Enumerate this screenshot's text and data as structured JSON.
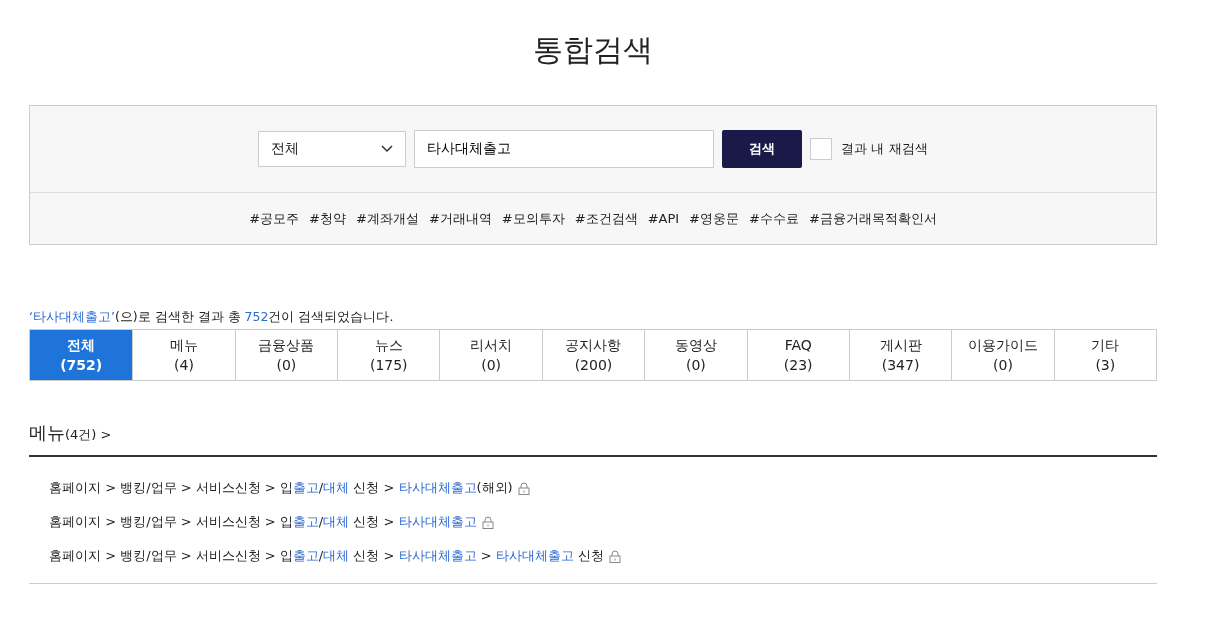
{
  "page_title": "통합검색",
  "search": {
    "category": "전체",
    "query": "타사대체출고",
    "button": "검색",
    "research": {
      "label": "결과 내 재검색",
      "checked": false
    }
  },
  "hashtags": [
    "#공모주",
    "#청약",
    "#계좌개설",
    "#거래내역",
    "#모의투자",
    "#조건검색",
    "#API",
    "#영웅문",
    "#수수료",
    "#금융거래목적확인서"
  ],
  "summary": [
    {
      "text": "‘타사대체출고’",
      "highlight": true
    },
    {
      "text": "(으)로 검색한 결과 총 ",
      "highlight": false
    },
    {
      "text": "752",
      "highlight": true
    },
    {
      "text": "건이 검색되었습니다.",
      "highlight": false
    }
  ],
  "tabs": [
    {
      "label": "전체",
      "count": "(752)",
      "selected": true
    },
    {
      "label": "메뉴",
      "count": "(4)",
      "selected": false
    },
    {
      "label": "금융상품",
      "count": "(0)",
      "selected": false
    },
    {
      "label": "뉴스",
      "count": "(175)",
      "selected": false
    },
    {
      "label": "리서치",
      "count": "(0)",
      "selected": false
    },
    {
      "label": "공지사항",
      "count": "(200)",
      "selected": false
    },
    {
      "label": "동영상",
      "count": "(0)",
      "selected": false
    },
    {
      "label": "FAQ",
      "count": "(23)",
      "selected": false
    },
    {
      "label": "게시판",
      "count": "(347)",
      "selected": false
    },
    {
      "label": "이용가이드",
      "count": "(0)",
      "selected": false
    },
    {
      "label": "기타",
      "count": "(3)",
      "selected": false
    }
  ],
  "section": {
    "title": "메뉴",
    "count": "(4건) >"
  },
  "results": [
    {
      "locked": true,
      "segments": [
        {
          "text": "홈페이지 > 뱅킹/업무 > 서비스신청 > 입",
          "highlight": false
        },
        {
          "text": "출고",
          "highlight": true
        },
        {
          "text": "/",
          "highlight": false
        },
        {
          "text": "대체",
          "highlight": true
        },
        {
          "text": " 신청 > ",
          "highlight": false
        },
        {
          "text": "타사대체출고",
          "highlight": true
        },
        {
          "text": "(해외)",
          "highlight": false
        }
      ]
    },
    {
      "locked": true,
      "segments": [
        {
          "text": "홈페이지 > 뱅킹/업무 > 서비스신청 > 입",
          "highlight": false
        },
        {
          "text": "출고",
          "highlight": true
        },
        {
          "text": "/",
          "highlight": false
        },
        {
          "text": "대체",
          "highlight": true
        },
        {
          "text": " 신청 > ",
          "highlight": false
        },
        {
          "text": "타사대체출고",
          "highlight": true
        }
      ]
    },
    {
      "locked": true,
      "segments": [
        {
          "text": "홈페이지 > 뱅킹/업무 > 서비스신청 > 입",
          "highlight": false
        },
        {
          "text": "출고",
          "highlight": true
        },
        {
          "text": "/",
          "highlight": false
        },
        {
          "text": "대체",
          "highlight": true
        },
        {
          "text": " 신청 > ",
          "highlight": false
        },
        {
          "text": "타사대체출고",
          "highlight": true
        },
        {
          "text": " > ",
          "highlight": false
        },
        {
          "text": "타사대체출고",
          "highlight": true
        },
        {
          "text": " 신청",
          "highlight": false
        }
      ]
    }
  ]
}
